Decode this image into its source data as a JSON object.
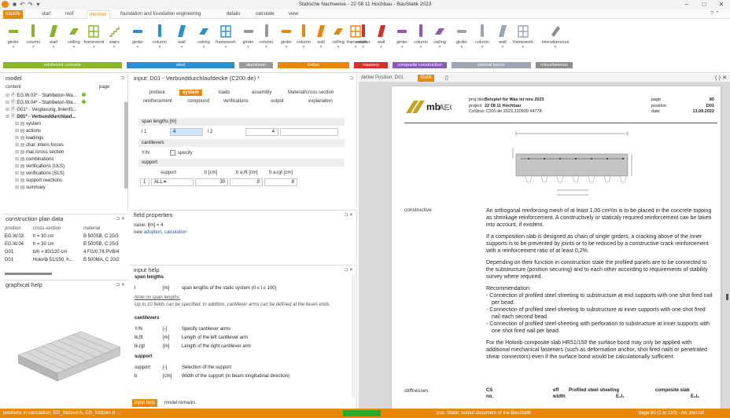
{
  "window": {
    "title": "Statische Nachweise - 22 08 11 Hochbau - BauStatik 2023"
  },
  "ribbon_tabs": [
    "baustik",
    "start",
    "roof",
    "member",
    "foundation and foundation engineering",
    "details",
    "calculate",
    "view"
  ],
  "ribbon_groups": [
    {
      "label": "reinforced concrete",
      "buttons": [
        "girder",
        "column",
        "wall",
        "ceiling",
        "framework",
        "stairs"
      ]
    },
    {
      "label": "steel",
      "buttons": [
        "girder",
        "column",
        "wall",
        "ceiling",
        "framework"
      ]
    },
    {
      "label": "aluminium",
      "buttons": [
        "girder",
        "column"
      ]
    },
    {
      "label": "timber",
      "buttons": [
        "girder",
        "column",
        "wall",
        "ceiling",
        "framework"
      ]
    },
    {
      "label": "masonry",
      "buttons": [
        "column",
        "wall"
      ]
    },
    {
      "label": "composite construction",
      "buttons": [
        "girder",
        "column",
        "ceiling"
      ]
    },
    {
      "label": "internal forces",
      "buttons": [
        "girder",
        "column",
        "wall",
        "framework"
      ]
    },
    {
      "label": "miscellaneous",
      "buttons": [
        "miscellaneous"
      ]
    }
  ],
  "colors": {
    "accent": "#e8880a",
    "rc": "#88b628",
    "steel": "#2a8fd0",
    "alu": "#9a9a9a",
    "timber": "#e8880a",
    "masonry": "#d2302c",
    "composite": "#8a5ab8",
    "forces": "#9aa6b2",
    "misc": "#8c8c8c"
  },
  "model": {
    "title": "model",
    "col_content": "content",
    "col_page": "page",
    "items": [
      "EG.W.03* - Stahlbeton-Wa...",
      "EG.W.04* - Stahlbeton-Wa...",
      "G01* - Verglasung, linienfö...",
      "D01* - Verbunddurchlauf..."
    ],
    "subitems": [
      "system",
      "actions",
      "loadings",
      "char. intern.forces",
      "mat./cross section",
      "combinations",
      "verifications (ULS)",
      "verifications (SLS)",
      "support reactions",
      "summary"
    ]
  },
  "construction_plan": {
    "title": "construction plan data",
    "headers": [
      "position",
      "cross-section",
      "material"
    ],
    "rows": [
      [
        "EG.W.03",
        "h = 30 cm",
        "B 500SB, C 25/3"
      ],
      [
        "EG.W.04",
        "h = 30 cm",
        "B 500SB, C 25/3"
      ],
      [
        "G01",
        "b/h = 80/120 cm",
        "4 FG/0.76 PVB/4"
      ],
      [
        "D01",
        "Holorib 51/150, h...",
        "B 500MA, C 20/2"
      ]
    ]
  },
  "graphical_help": {
    "title": "graphical help"
  },
  "input": {
    "title": "input: D01 - Verbunddurchlaufdecke (C200 de) *",
    "tabs_row1": [
      "preface",
      "system",
      "loads",
      "assembly",
      "Material/cross section"
    ],
    "tabs_row2": [
      "reinforcement",
      "compound",
      "verifications",
      "output",
      "explanation"
    ],
    "span_lengths_label": "span lengths [m]",
    "l1_label": "l 1",
    "l1_value": "4",
    "l2_label": "l 2",
    "l2_value": "4",
    "cantilevers_label": "cantilevers",
    "yn_label": "Y/N",
    "specify_label": "specify",
    "support_label": "support",
    "support_headers": [
      "support",
      "b [cm]",
      "b a,lft [cm]",
      "b a,rgt [cm]"
    ],
    "support_row": [
      "1",
      "ALL",
      "30",
      "8",
      "8"
    ]
  },
  "field_properties": {
    "title": "field properties",
    "value_line": "value: l[m] = 4",
    "new_prefix": "new",
    "adoption": "adoption",
    "calculation": "calculation"
  },
  "input_help": {
    "title": "input help",
    "section1": "span lengths",
    "row_l": [
      "l",
      "[m]",
      "span lengths of the static system (0 ≤ l ≤ 100)"
    ],
    "note_title": "Note on span lengths:",
    "note_text": "Up to 10 fields can be specified. In addition, cantilever arms can be defined at the beam ends.",
    "section2": "cantilevers",
    "rows2": [
      [
        "Y/N",
        "[-]",
        "Specify cantilever arms"
      ],
      [
        "lk,lft",
        "[m]",
        "Length of the left cantilever arm"
      ],
      [
        "lk,rgt",
        "[m]",
        "Length of the right cantilever arm"
      ]
    ],
    "section3": "support",
    "rows3": [
      [
        "support",
        "[-]",
        "Selection of the support"
      ],
      [
        "b",
        "[cm]",
        "Width of the support (in beam longitudinal direction)"
      ]
    ],
    "tabs": [
      "input help",
      "model remarks"
    ]
  },
  "document": {
    "toolbar": [
      "Aktive Position: D01",
      "Statik"
    ],
    "header": {
      "proj_des_label": "proj.des.",
      "proj_des": "Beispiel für Was ist neu 2023",
      "project_label": "project",
      "project": "22 08 11 Hochbau",
      "code": "CoStruc C200.de  2023.220909 #4778",
      "page_label": "page",
      "page": "80",
      "position_label": "position",
      "position": "D01",
      "date_label": "date",
      "date": "13.09.2022"
    },
    "constructive_label": "constructive",
    "paragraphs": [
      "An orthogonal reinforcing mesh of at least 1,00 cm²/m is to be placed in the concrete topping as shrinkage reinforcement. A constructively or staticaly required reinforcement can be taken into account, if existent.",
      "If a composition slab is designed as chain of single girders, a cracking above of the inner supports is to be prevented by joints or to be reduced by a constructive crack reinforcement with a reinforcement ratio of at least 0,2%.",
      "Depending on their function in construction state the profiled panels are to be connected to the substructure (position securing) and to each other according to requirements of stability survey where required.",
      "Recommendation:",
      "-  Connection of profiled steel sheeting to substructure at end supports with one shot fired nail per bead.",
      "-  Connection of profiled steel sheeting to substructure at inner supports with one shot fired nail each second bead.",
      "-  Connection of profiled steel sheeting with perforation to substructure at inner supports with one shot fired nail per bead.",
      "For the Holorib composite slab HR51/150 the surface bond may only be applied with additional mechanical fasteners (such as deformation anchor, shot fired nails or penetrated shear connectors) even if the surface bond would be calculationally sufficient."
    ],
    "stiffnesses_label": "stiffnesses",
    "stiff_headers": [
      "CS",
      "eff",
      "Profiled steel sheeting",
      "composite slab"
    ],
    "stiff_sub": [
      "no.",
      "width",
      "E₁I₁",
      "E₂I₂"
    ]
  },
  "status": {
    "left": "positions in calculation: EG_Stützen A, EG_Stützen B ...",
    "mid": "pos. Statik: output document of the BauStatik",
    "right": "page 80 (1 to 110) - A4, portrait"
  }
}
